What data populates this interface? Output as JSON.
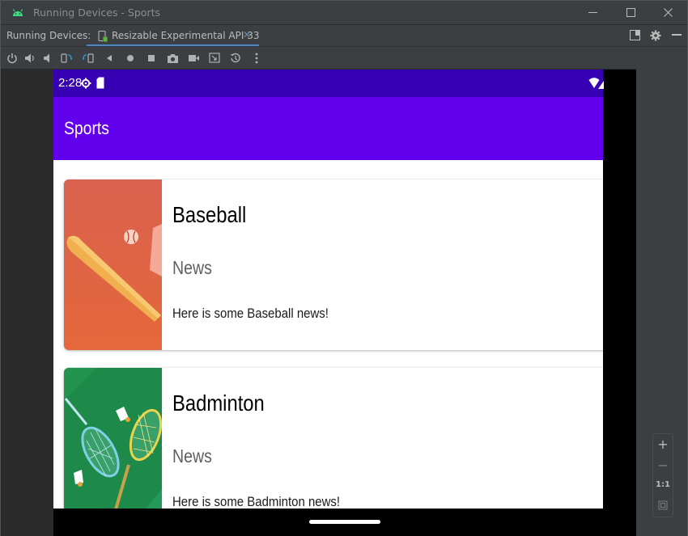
{
  "window": {
    "title": "Running Devices - Sports",
    "minimize_icon": "minimize-icon",
    "maximize_icon": "maximize-icon",
    "close_icon": "close-icon"
  },
  "tabs_bar": {
    "label": "Running Devices:",
    "active_tab": "Resizable Experimental API 33",
    "accent_color": "#4a88c7"
  },
  "toolbar": {
    "icons": [
      "power-icon",
      "volume-up-icon",
      "volume-down-icon",
      "rotate-left-icon",
      "rotate-right-icon",
      "back-icon",
      "home-icon",
      "overview-icon",
      "screenshot-icon",
      "screen-record-icon",
      "display-mode-icon",
      "snapshot-icon",
      "more-icon"
    ]
  },
  "device": {
    "status_bar": {
      "time": "2:28",
      "color": "#3700b3"
    },
    "app_bar": {
      "title": "Sports",
      "color": "#6200ee"
    },
    "cards": [
      {
        "title": "Baseball",
        "subtitle": "News",
        "description": "Here is some Baseball news!",
        "image": "baseball-illustration"
      },
      {
        "title": "Badminton",
        "subtitle": "News",
        "description": "Here is some Badminton news!",
        "image": "badminton-illustration"
      }
    ]
  },
  "zoom_panel": {
    "zoom_in": "+",
    "zoom_out": "−",
    "actual_size": "1:1",
    "fit_icon": "fit-screen-icon"
  }
}
